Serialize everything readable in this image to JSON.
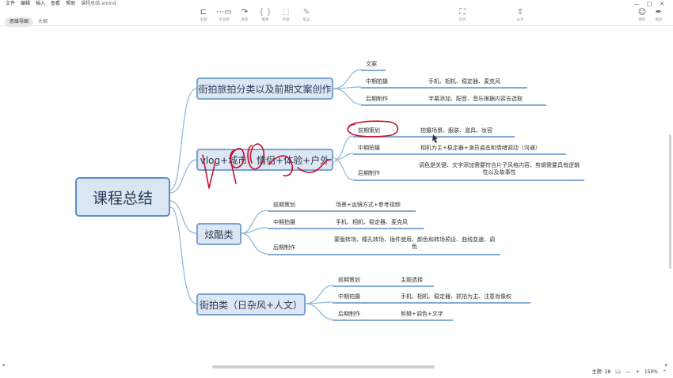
{
  "menubar": {
    "items": [
      "文件",
      "编辑",
      "插入",
      "查看",
      "帮助"
    ],
    "filename": "课程总结.xmind"
  },
  "window_controls": {
    "minimize": "—",
    "maximize": "□",
    "close": "✕"
  },
  "view_tabs": {
    "mindmap": "思维导图",
    "outline": "大纲"
  },
  "toolbar": {
    "topic": "主题",
    "subtopic": "子主题",
    "connection": "联系",
    "summary": "概要",
    "boundary": "外框",
    "note": "笔记",
    "zen": "ZEN",
    "share": "分享",
    "icons": "图标",
    "format": "格式"
  },
  "mindmap": {
    "root": "课程总结",
    "branches": [
      {
        "title": "街拍旅拍分类以及前期文案创作",
        "children": [
          {
            "label": "文案",
            "detail": ""
          },
          {
            "label": "中期拍摄",
            "detail": "手机、相机、稳定器、麦克风"
          },
          {
            "label": "后期制作",
            "detail": "字幕添加、配音、音乐根据内容去选取"
          }
        ]
      },
      {
        "title": "vlog+城市、情侣+体验+户外",
        "children": [
          {
            "label": "前期策划",
            "detail": "拍摄场景、服装、道具、妆容"
          },
          {
            "label": "中期拍摄",
            "detail": "相机为主+稳定器+演员姿态和情绪调动（沟通）"
          },
          {
            "label": "后期制作",
            "detail": "调色是关键、文字添加需要符合片子风格内容、剪辑需要具有逻辑性以及故事性"
          }
        ]
      },
      {
        "title": "炫酷类",
        "children": [
          {
            "label": "前期策划",
            "detail": "场景+运镜方式+参考视频"
          },
          {
            "label": "中期拍摄",
            "detail": "手机、相机、稳定器、麦克风"
          },
          {
            "label": "后期制作",
            "detail": "蒙版转场、瞳孔转场、插件使用、颜色和转场预设、曲线变速、调色"
          }
        ]
      },
      {
        "title": "街拍类（日杂风+人文）",
        "children": [
          {
            "label": "前期策划",
            "detail": "主题选择"
          },
          {
            "label": "中期拍摄",
            "detail": "手机、相机、稳定器、抓拍为主、注意肖像权"
          },
          {
            "label": "后期制作",
            "detail": "剪辑+调色+文字"
          }
        ]
      }
    ]
  },
  "status": {
    "topic_count": "主题: 28",
    "zoom": "150%",
    "zoom_out": "—",
    "zoom_in": "+"
  },
  "colors": {
    "branch_line": "#8fb4da",
    "underline": "#5b8ec7",
    "annotation": "#c8102e"
  }
}
